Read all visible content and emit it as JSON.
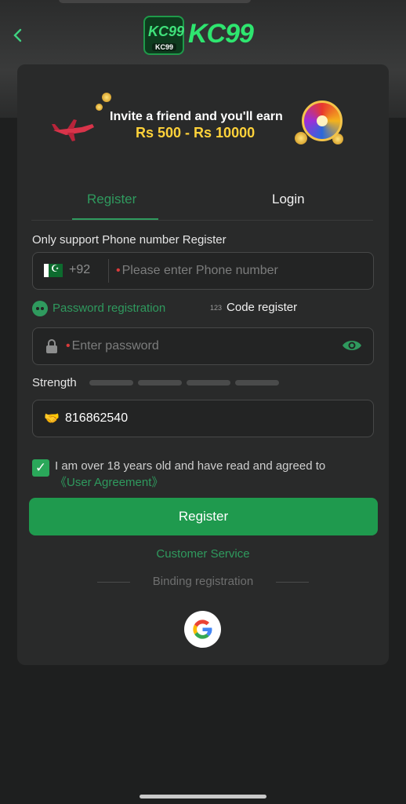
{
  "brand": {
    "logo_mark_text": "KC99",
    "logo_sub_text": "KC99",
    "wordmark": "KC99"
  },
  "banner": {
    "line1": "Invite a friend and you'll earn",
    "line2": "Rs 500 - Rs 10000"
  },
  "tabs": [
    {
      "label": "Register",
      "active": true
    },
    {
      "label": "Login",
      "active": false
    }
  ],
  "form": {
    "phone_label": "Only support Phone number Register",
    "country_code": "+92",
    "phone_placeholder": "Please enter Phone number",
    "password_option": "Password registration",
    "code_option_icon_text": "123",
    "code_option": "Code register",
    "password_placeholder": "Enter password",
    "strength_label": "Strength",
    "invite_code_value": "816862540",
    "agreement_text": "I am over 18 years old and have read and agreed to",
    "user_agreement_link": "《User Agreement》",
    "submit_label": "Register"
  },
  "customer_service": "Customer Service",
  "binding_label": "Binding registration",
  "colors": {
    "accent": "#2f9a5e",
    "button": "#1f9a4e",
    "background": "#1e1f1f",
    "card": "#292a2a"
  },
  "icons": [
    "back-chevron-icon",
    "pakistan-flag-icon",
    "lock-icon",
    "eye-icon",
    "handshake-icon",
    "google-icon"
  ]
}
